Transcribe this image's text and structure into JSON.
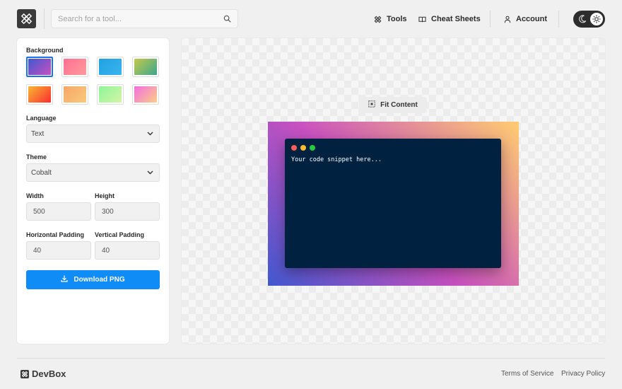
{
  "header": {
    "search_placeholder": "Search for a tool...",
    "nav": {
      "tools": "Tools",
      "cheat_sheets": "Cheat Sheets",
      "account": "Account"
    }
  },
  "sidebar": {
    "background_label": "Background",
    "backgrounds": [
      {
        "name": "purple-blue",
        "gradient": "linear-gradient(135deg,#4158d0,#c850c0)",
        "selected": true
      },
      {
        "name": "pink",
        "gradient": "linear-gradient(135deg,#ff6f91,#ff9a9e)",
        "selected": false
      },
      {
        "name": "blue",
        "gradient": "linear-gradient(135deg,#1fa2e0,#3bb4ef)",
        "selected": false
      },
      {
        "name": "green-yellow",
        "gradient": "linear-gradient(135deg,#c4c94a,#3ba78d)",
        "selected": false
      },
      {
        "name": "red-orange",
        "gradient": "linear-gradient(135deg,#f7b733,#fc2d2d)",
        "selected": false
      },
      {
        "name": "orange",
        "gradient": "linear-gradient(135deg,#f6a66a,#f9c97a)",
        "selected": false
      },
      {
        "name": "lime",
        "gradient": "linear-gradient(135deg,#8df59b,#d4f5a4)",
        "selected": false
      },
      {
        "name": "pink-orange",
        "gradient": "linear-gradient(135deg,#f36de0,#fbcf85)",
        "selected": false
      }
    ],
    "language_label": "Language",
    "language_value": "Text",
    "theme_label": "Theme",
    "theme_value": "Cobalt",
    "width_label": "Width",
    "width_value": "500",
    "height_label": "Height",
    "height_value": "300",
    "hpad_label": "Horizontal Padding",
    "hpad_value": "40",
    "vpad_label": "Vertical Padding",
    "vpad_value": "40",
    "download_label": "Download PNG"
  },
  "canvas": {
    "fit_label": "Fit Content",
    "code_text": "Your code snippet here...",
    "window_dots": [
      "#ff5f57",
      "#febc2e",
      "#28c840"
    ],
    "code_bg": "#002240"
  },
  "footer": {
    "brand": "DevBox",
    "terms": "Terms of Service",
    "privacy": "Privacy Policy"
  },
  "colors": {
    "accent": "#0f8cf5",
    "selected_border": "#1a73e8"
  }
}
